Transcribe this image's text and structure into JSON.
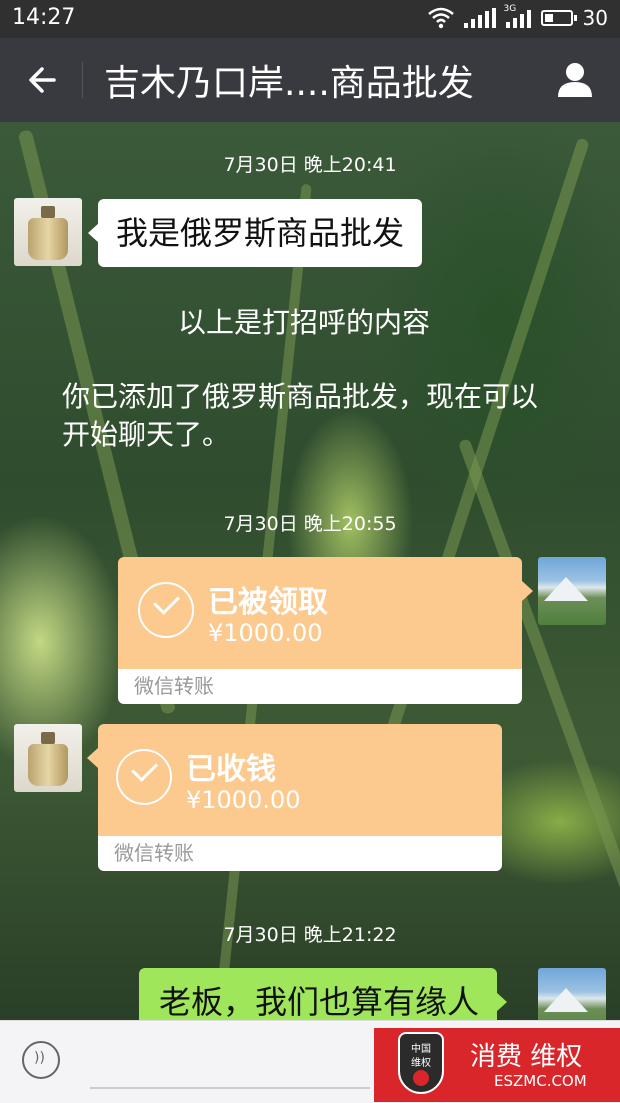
{
  "status_bar": {
    "time": "14:27",
    "network_label": "3G",
    "battery": "30"
  },
  "header": {
    "title": "吉木乃口岸....商品批发"
  },
  "chat": {
    "messages": [
      {
        "type": "timestamp",
        "text": "7月30日 晚上20:41"
      },
      {
        "type": "text",
        "side": "left",
        "text": "我是俄罗斯商品批发"
      },
      {
        "type": "system",
        "text": "以上是打招呼的内容"
      },
      {
        "type": "system",
        "text": "你已添加了俄罗斯商品批发，现在可以开始聊天了。"
      },
      {
        "type": "timestamp",
        "text": "7月30日 晚上20:55"
      },
      {
        "type": "transfer",
        "side": "right",
        "status": "已被领取",
        "amount": "¥1000.00",
        "label": "微信转账"
      },
      {
        "type": "transfer",
        "side": "left",
        "status": "已收钱",
        "amount": "¥1000.00",
        "label": "微信转账"
      },
      {
        "type": "timestamp",
        "text": "7月30日 晚上21:22"
      },
      {
        "type": "text",
        "side": "right",
        "text": "老板，我们也算有缘人"
      }
    ]
  },
  "watermark": {
    "shield_top": "中国",
    "shield_bottom": "维权",
    "title": "消费 维权",
    "site": "ESZMC.COM"
  },
  "colors": {
    "header_bg": "#393a3f",
    "transfer_orange": "#fcc98f",
    "sent_green": "#9fe65a",
    "badge_red": "#d8262b"
  }
}
